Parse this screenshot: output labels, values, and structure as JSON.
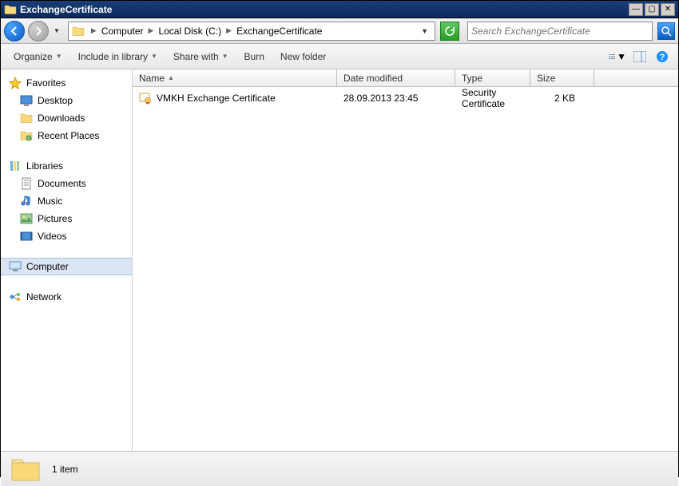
{
  "window": {
    "title": "ExchangeCertificate"
  },
  "breadcrumb": {
    "parts": [
      "Computer",
      "Local Disk (C:)",
      "ExchangeCertificate"
    ]
  },
  "search": {
    "placeholder": "Search ExchangeCertificate"
  },
  "toolbar": {
    "organize": "Organize",
    "include": "Include in library",
    "share": "Share with",
    "burn": "Burn",
    "newfolder": "New folder"
  },
  "sidebar": {
    "favorites": {
      "label": "Favorites",
      "items": [
        "Desktop",
        "Downloads",
        "Recent Places"
      ]
    },
    "libraries": {
      "label": "Libraries",
      "items": [
        "Documents",
        "Music",
        "Pictures",
        "Videos"
      ]
    },
    "computer": {
      "label": "Computer"
    },
    "network": {
      "label": "Network"
    }
  },
  "columns": {
    "name": "Name",
    "date": "Date modified",
    "type": "Type",
    "size": "Size"
  },
  "files": [
    {
      "name": "VMKH Exchange Certificate",
      "date": "28.09.2013 23:45",
      "type": "Security Certificate",
      "size": "2 KB"
    }
  ],
  "status": {
    "count": "1 item"
  }
}
